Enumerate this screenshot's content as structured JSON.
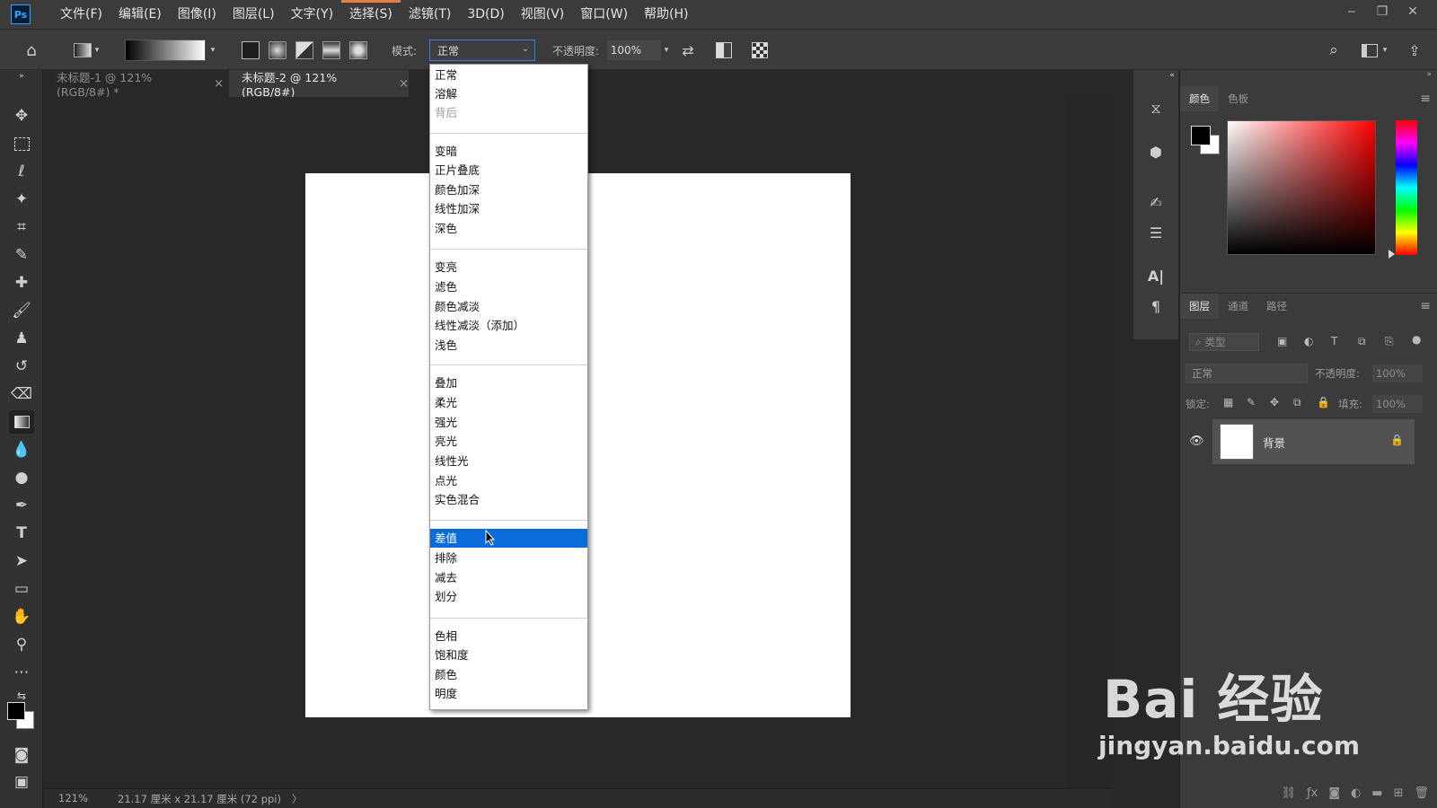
{
  "app": {
    "logo": "Ps"
  },
  "menu": {
    "items": [
      "文件(F)",
      "编辑(E)",
      "图像(I)",
      "图层(L)",
      "文字(Y)",
      "选择(S)",
      "滤镜(T)",
      "3D(D)",
      "视图(V)",
      "窗口(W)",
      "帮助(H)"
    ]
  },
  "window_controls": {
    "minimize": "‒",
    "restore": "❐",
    "close": "✕"
  },
  "options": {
    "mode_label": "模式:",
    "mode_value": "正常",
    "opacity_label": "不透明度:",
    "opacity_value": "100%"
  },
  "tabs": [
    {
      "title": "未标题-1 @ 121%(RGB/8#) *",
      "close": "×"
    },
    {
      "title": "未标题-2 @ 121%(RGB/8#)",
      "close": "×"
    }
  ],
  "blend_modes": {
    "selected": "差值",
    "groups": [
      [
        "正常",
        "溶解",
        "背后"
      ],
      [
        "变暗",
        "正片叠底",
        "颜色加深",
        "线性加深",
        "深色"
      ],
      [
        "变亮",
        "滤色",
        "颜色减淡",
        "线性减淡（添加）",
        "浅色"
      ],
      [
        "叠加",
        "柔光",
        "强光",
        "亮光",
        "线性光",
        "点光",
        "实色混合"
      ],
      [
        "差值",
        "排除",
        "减去",
        "划分"
      ],
      [
        "色相",
        "饱和度",
        "颜色",
        "明度"
      ]
    ],
    "disabled": [
      "背后"
    ]
  },
  "color_panel": {
    "tabs": [
      "颜色",
      "色板"
    ],
    "foreground": "#000000",
    "background": "#ffffff"
  },
  "layers_panel": {
    "tabs": [
      "图层",
      "通道",
      "路径"
    ],
    "filter_placeholder": "类型",
    "blend_value": "正常",
    "opacity_label": "不透明度:",
    "opacity_value": "100%",
    "lock_label": "锁定:",
    "fill_label": "填充:",
    "fill_value": "100%",
    "layers": [
      {
        "name": "背景",
        "locked": true,
        "visible": true
      }
    ]
  },
  "status": {
    "zoom": "121%",
    "doc_info": "21.17 厘米 x 21.17 厘米 (72 ppi)",
    "arrow": "〉"
  },
  "watermark": {
    "logo_text": "Bai 经验",
    "url": "jingyan.baidu.com"
  }
}
